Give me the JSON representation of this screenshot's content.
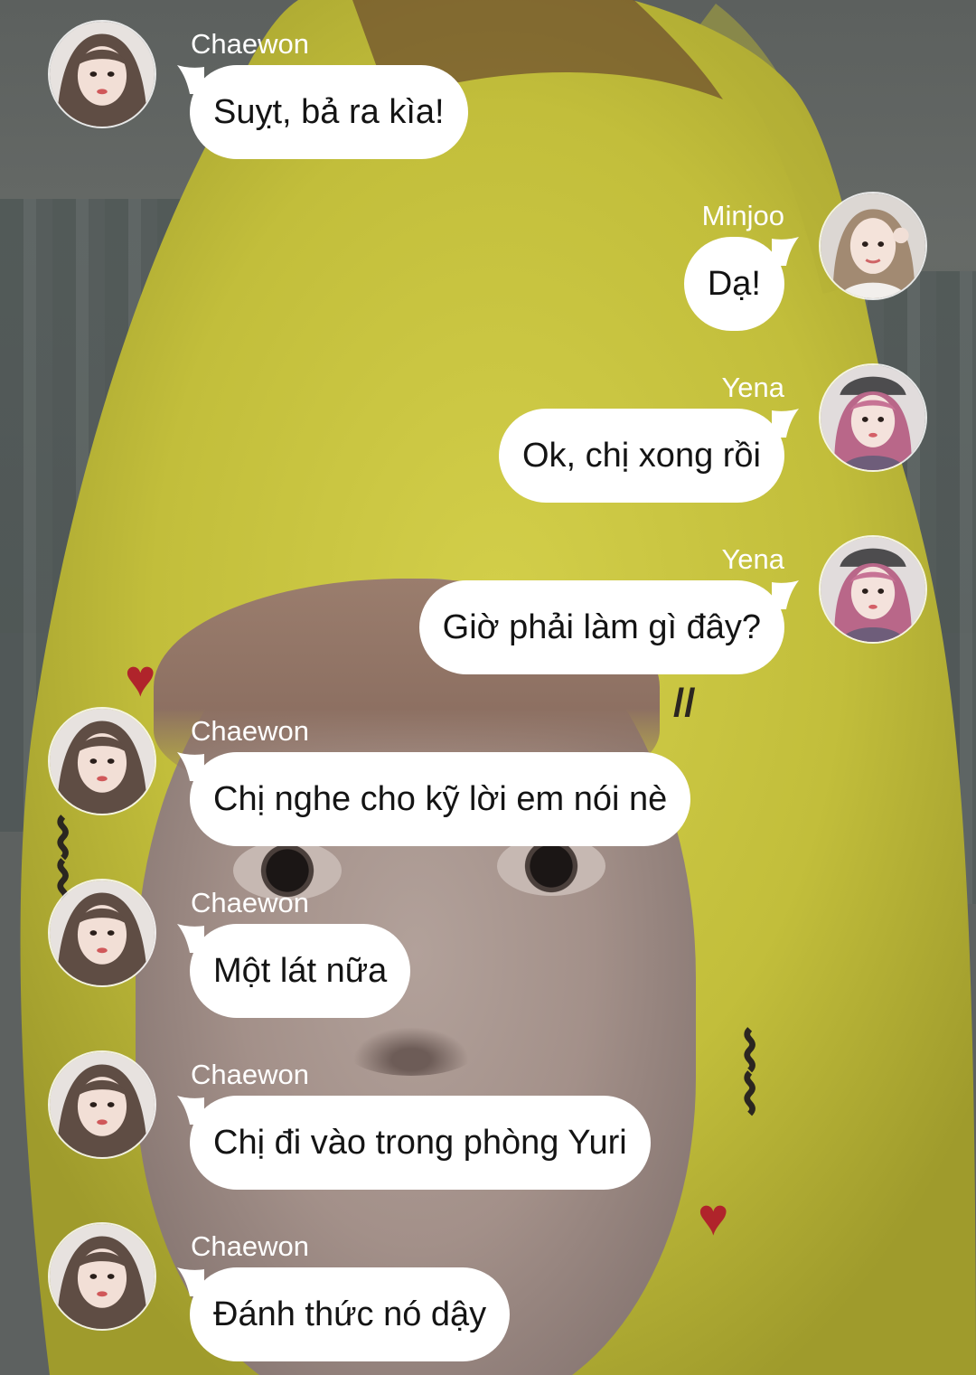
{
  "messages": [
    {
      "sender": "Chaewon",
      "text": "Suỵt, bả ra kìa!",
      "side": "left"
    },
    {
      "sender": "Minjoo",
      "text": "Dạ!",
      "side": "right"
    },
    {
      "sender": "Yena",
      "text": "Ok, chị xong rồi",
      "side": "right"
    },
    {
      "sender": "Yena",
      "text": "Giờ phải làm gì đây?",
      "side": "right"
    },
    {
      "sender": "Chaewon",
      "text": "Chị nghe cho kỹ lời em nói nè",
      "side": "left"
    },
    {
      "sender": "Chaewon",
      "text": "Một lát nữa",
      "side": "left"
    },
    {
      "sender": "Chaewon",
      "text": "Chị đi vào trong phòng Yuri",
      "side": "left"
    },
    {
      "sender": "Chaewon",
      "text": "Đánh thức nó dậy",
      "side": "left"
    }
  ],
  "colors": {
    "bubble": "#ffffff",
    "bubble_text": "#141414",
    "name_text": "#ffffff",
    "banana_yellow": "#c9c53e"
  },
  "icons": {
    "avatar_chaewon": "avatar-chaewon-photo",
    "avatar_minjoo": "avatar-minjoo-photo",
    "avatar_yena": "avatar-yena-photo"
  }
}
